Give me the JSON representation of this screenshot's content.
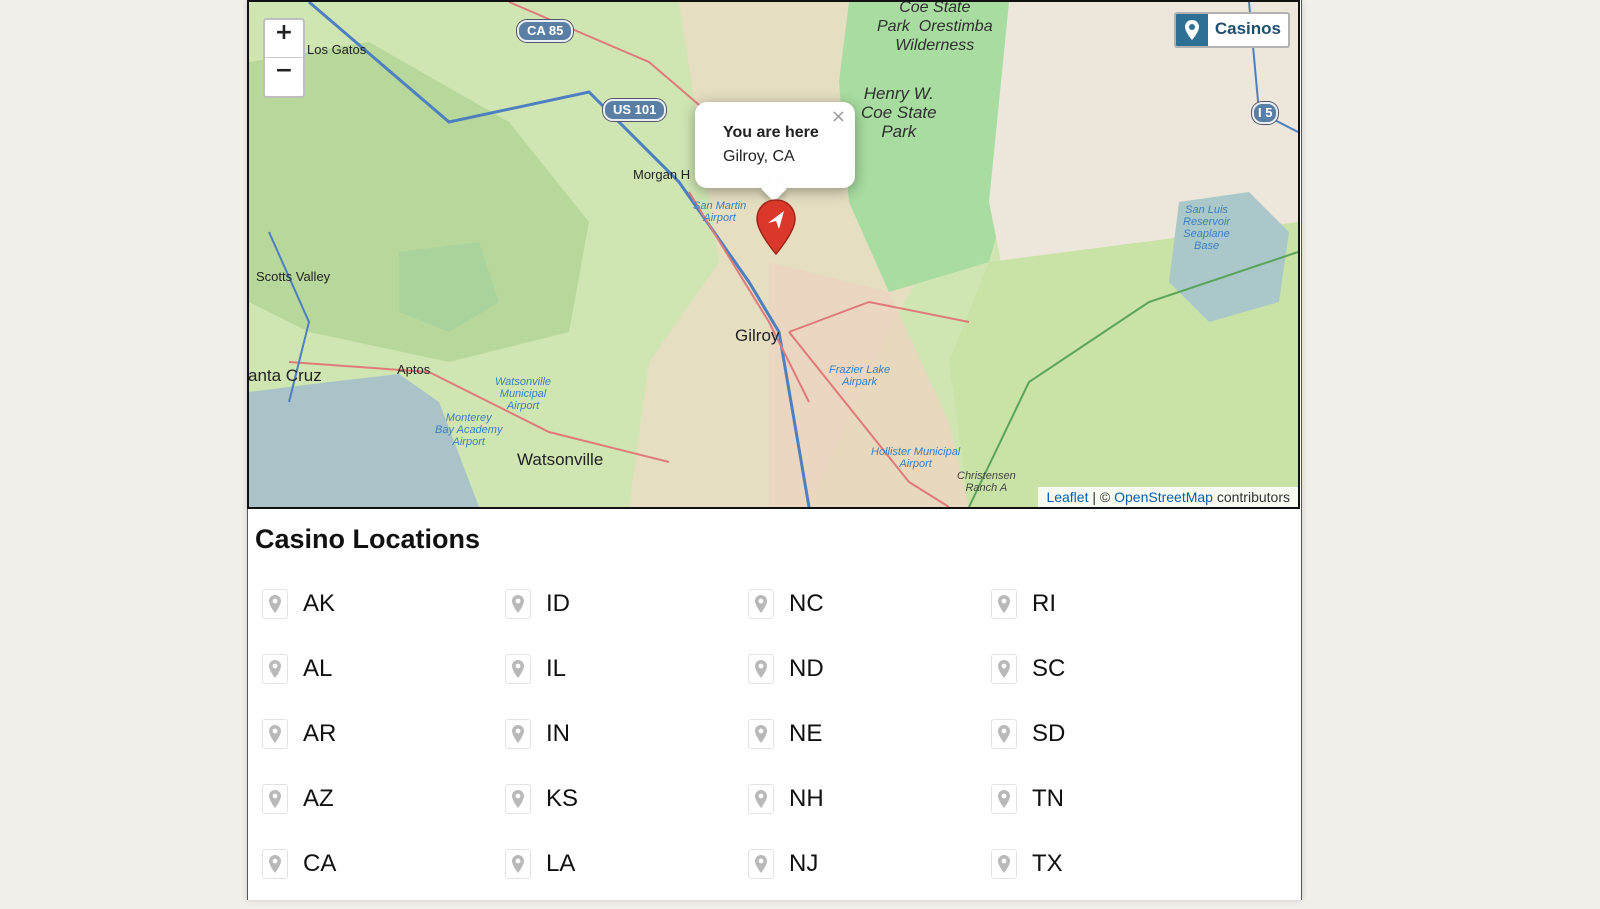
{
  "map": {
    "zoom_in": "+",
    "zoom_out": "−",
    "layer_button": "Casinos",
    "popup": {
      "title": "You are here",
      "location": "Gilroy, CA",
      "close": "×"
    },
    "attribution": {
      "leaflet": "Leaflet",
      "separator": " | © ",
      "osm": "OpenStreetMap",
      "suffix": " contributors"
    },
    "labels": {
      "los_gatos": "Los Gatos",
      "morgan_hill": "Morgan H",
      "scotts_valley": "Scotts Valley",
      "santa_cruz": "anta Cruz",
      "aptos": "Aptos",
      "gilroy": "Gilroy",
      "watsonville": "Watsonville",
      "coe_top": "Coe State\nPark  Orestimba\nWilderness",
      "henry_coe": "Henry W.\nCoe State\nPark",
      "san_martin_airport": "San Martin\nAirport",
      "watsonville_airport": "Watsonville\nMunicipal\nAirport",
      "monterey_airport": "Monterey\nBay Academy\nAirport",
      "frazier_airpark": "Frazier Lake\nAirpark",
      "hollister_airport": "Hollister Municipal\nAirport",
      "san_luis_base": "San Luis\nReservoir\nSeaplane\nBase",
      "christensen": "Christensen\nRanch A"
    },
    "shields": {
      "ca85": "CA 85",
      "us101": "US 101",
      "i5": "I 5"
    }
  },
  "casino_section": {
    "heading": "Casino Locations",
    "states": [
      [
        "AK",
        "ID",
        "NC",
        "RI"
      ],
      [
        "AL",
        "IL",
        "ND",
        "SC"
      ],
      [
        "AR",
        "IN",
        "NE",
        "SD"
      ],
      [
        "AZ",
        "KS",
        "NH",
        "TN"
      ],
      [
        "CA",
        "LA",
        "NJ",
        "TX"
      ]
    ]
  },
  "colors": {
    "accent": "#2e6f95",
    "marker": "#d9382b",
    "link": "#0060b0"
  }
}
